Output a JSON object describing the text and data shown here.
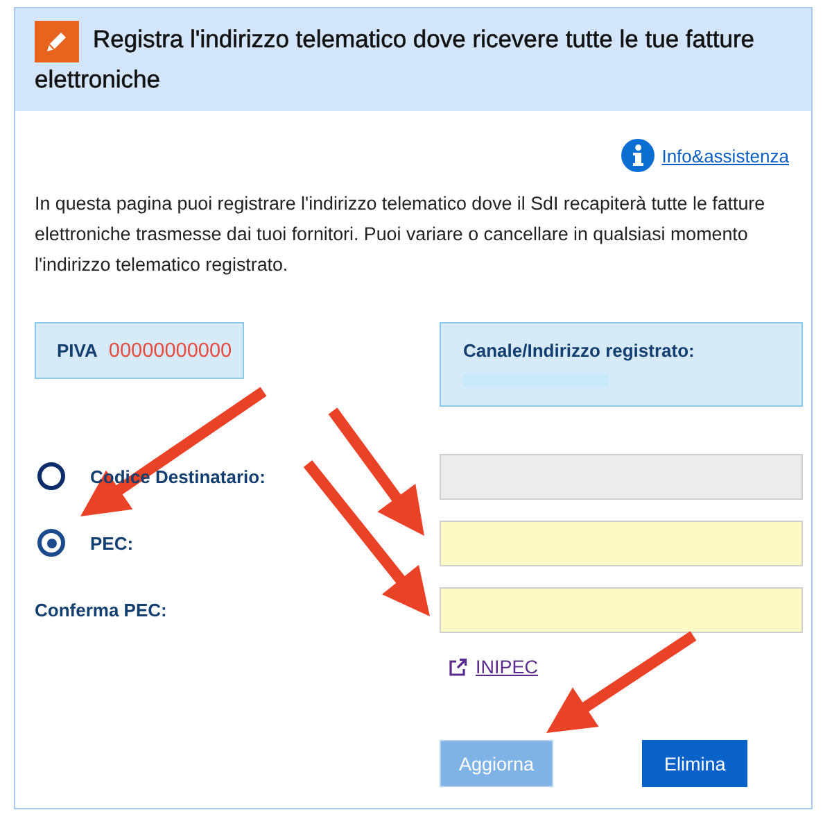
{
  "header": {
    "title": "Registra l'indirizzo telematico dove ricevere tutte le tue fatture elettroniche"
  },
  "info_link": "Info&assistenza",
  "intro": "In questa pagina puoi registrare l'indirizzo telematico dove il SdI recapiterà tutte le fatture elettroniche trasmesse dai tuoi fornitori. Puoi variare o cancellare in qualsiasi momento l'indirizzo telematico registrato.",
  "piva": {
    "label": "PIVA",
    "value": "00000000000"
  },
  "registered": {
    "label": "Canale/Indirizzo registrato:"
  },
  "options": [
    {
      "label": "Codice Destinatario:",
      "selected": false,
      "field_disabled": true
    },
    {
      "label": "PEC:",
      "selected": true,
      "field_disabled": false
    }
  ],
  "confirm": {
    "label": "Conferma PEC:",
    "field_disabled": false
  },
  "inipec_link": "INIPEC",
  "buttons": [
    {
      "label": "Aggiorna",
      "disabled": true
    },
    {
      "label": "Elimina",
      "disabled": false
    }
  ]
}
